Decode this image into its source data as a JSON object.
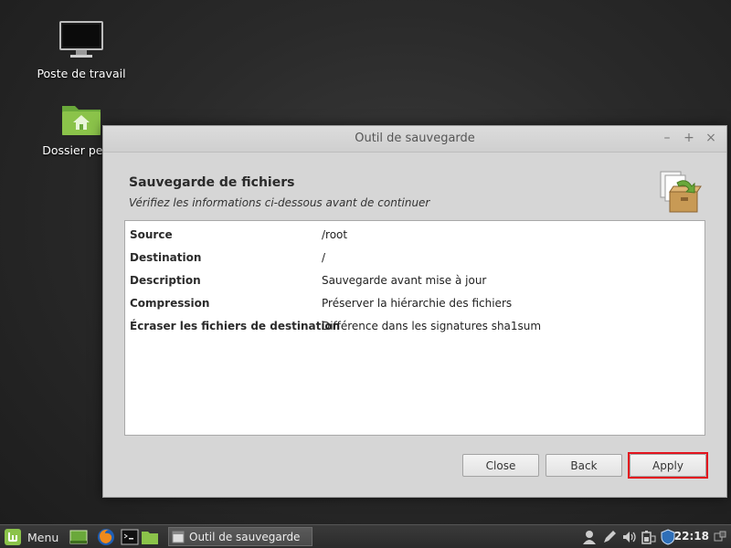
{
  "desktop": {
    "icons": [
      {
        "label": "Poste de travail",
        "icon": "monitor-icon"
      },
      {
        "label": "Dossier perso",
        "icon": "home-folder-icon"
      }
    ]
  },
  "window": {
    "title": "Outil de sauvegarde",
    "controls": {
      "minimize": "–",
      "maximize": "+",
      "close": "×"
    },
    "heading": "Sauvegarde de fichiers",
    "subheading": "Vérifiez les informations ci-dessous avant de continuer",
    "header_icon": "backup-box-icon",
    "info": [
      {
        "key": "Source",
        "value": "/root"
      },
      {
        "key": "Destination",
        "value": "/"
      },
      {
        "key": "Description",
        "value": "Sauvegarde avant mise à jour"
      },
      {
        "key": "Compression",
        "value": "Préserver la hiérarchie des fichiers"
      },
      {
        "key": "Écraser les fichiers de destination",
        "value": "Différence dans les signatures sha1sum"
      }
    ],
    "buttons": {
      "close": "Close",
      "back": "Back",
      "apply": "Apply"
    }
  },
  "taskbar": {
    "menu_label": "Menu",
    "task_label": "Outil de sauvegarde",
    "clock": "22:18"
  },
  "colors": {
    "highlight": "#e3141e",
    "mint_green": "#8bc34a"
  }
}
